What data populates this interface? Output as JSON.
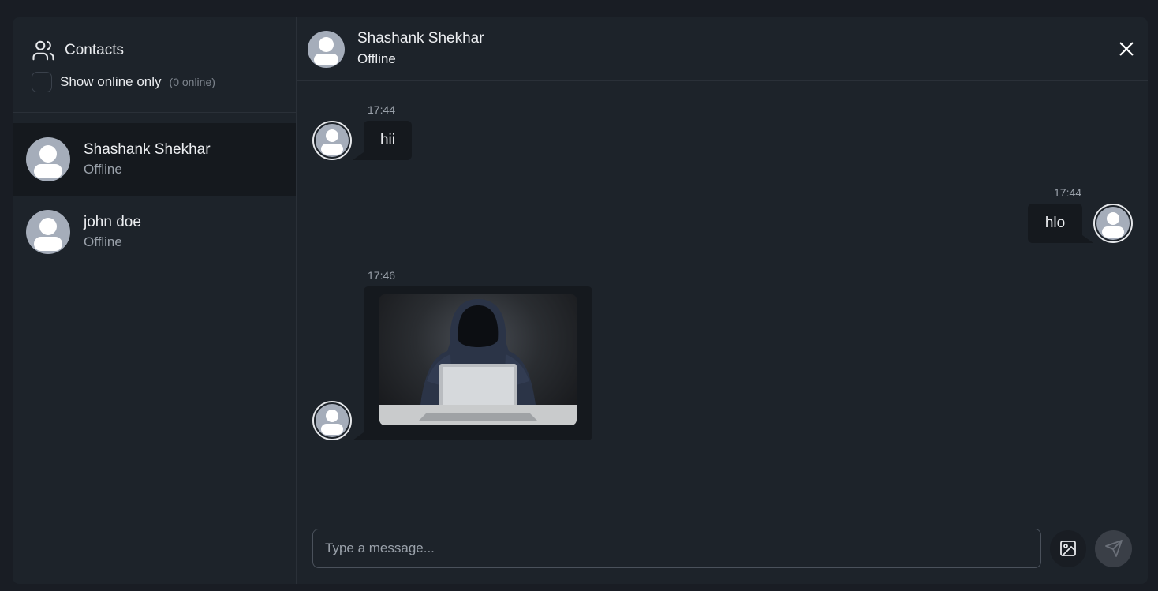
{
  "sidebar": {
    "title": "Contacts",
    "filter_label": "Show online only",
    "online_count": "(0 online)",
    "contacts": [
      {
        "name": "Shashank Shekhar",
        "status": "Offline",
        "active": true
      },
      {
        "name": "john doe",
        "status": "Offline",
        "active": false
      }
    ]
  },
  "chat": {
    "header": {
      "name": "Shashank Shekhar",
      "status": "Offline"
    },
    "messages": [
      {
        "time": "17:44",
        "text": "hii",
        "side": "left"
      },
      {
        "time": "17:44",
        "text": "hlo",
        "side": "right"
      },
      {
        "time": "17:46",
        "text": "",
        "side": "left",
        "image": "hooded figure with laptop"
      }
    ],
    "input_placeholder": "Type a message..."
  },
  "colors": {
    "background": "#1d232a",
    "bubble": "#15191e",
    "active_contact": "#15191e",
    "avatar": "#a5adba"
  },
  "icons": {
    "contacts": "users-icon",
    "close": "close-icon",
    "image": "image-icon",
    "send": "send-icon"
  }
}
